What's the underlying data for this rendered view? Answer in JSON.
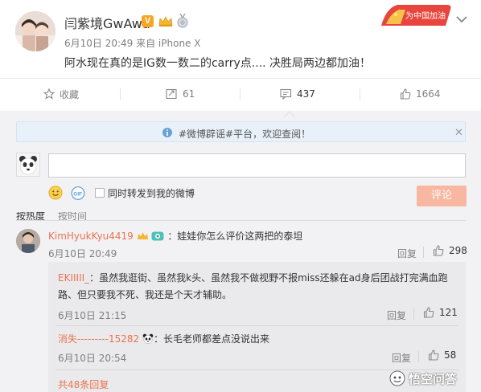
{
  "post": {
    "author": "闫紫境GwAwa",
    "verified_badge": "V",
    "meta": "6月10日 20:49 来自 iPhone X",
    "text": "阿水现在真的是IG数一数二的carry点.... 决胜局两边都加油！",
    "corner_banner": "为中国加油"
  },
  "actions": [
    {
      "label": "收藏",
      "icon": "bookmark-icon"
    },
    {
      "label": "61",
      "icon": "repost-icon"
    },
    {
      "label": "437",
      "icon": "comment-icon"
    },
    {
      "label": "1664",
      "icon": "like-icon"
    }
  ],
  "notice": {
    "text": "#微博辟谣#平台，欢迎查阅！",
    "close": "✕"
  },
  "composer": {
    "input_value": "",
    "repost_label": "同时转发到我的微博",
    "repost_checked": false,
    "submit_label": "评论"
  },
  "sort": {
    "first": "按热度",
    "second": "按时间"
  },
  "comment": {
    "user": "KimHyukKyu4419",
    "text": "：娃娃你怎么评价这两把的泰坦",
    "time": "6月10日 20:49",
    "reply_label": "回复",
    "likes": "298"
  },
  "replies": [
    {
      "user": "EKIIIII_",
      "text": "：虽然我逛街、虽然我k头、虽然我不做视野不报miss还躲在ad身后团战打完满血跑路、但只要我不死、我还是个天才辅助。",
      "time": "6月10日 21:15",
      "reply_label": "回复",
      "likes": "121"
    },
    {
      "user": "消失---------15282",
      "text": "：长毛老师都差点没说出来",
      "time": "6月10日 20:54",
      "reply_label": "回复",
      "likes": "58"
    }
  ],
  "total_replies": "共48条回复",
  "watermark": "悟空问答",
  "colors": {
    "accent_orange": "#eb7350",
    "submit_disabled": "#f7b7a0",
    "comment_area_bg": "#f2f2f5",
    "notice_bg": "#e8f1fa"
  }
}
